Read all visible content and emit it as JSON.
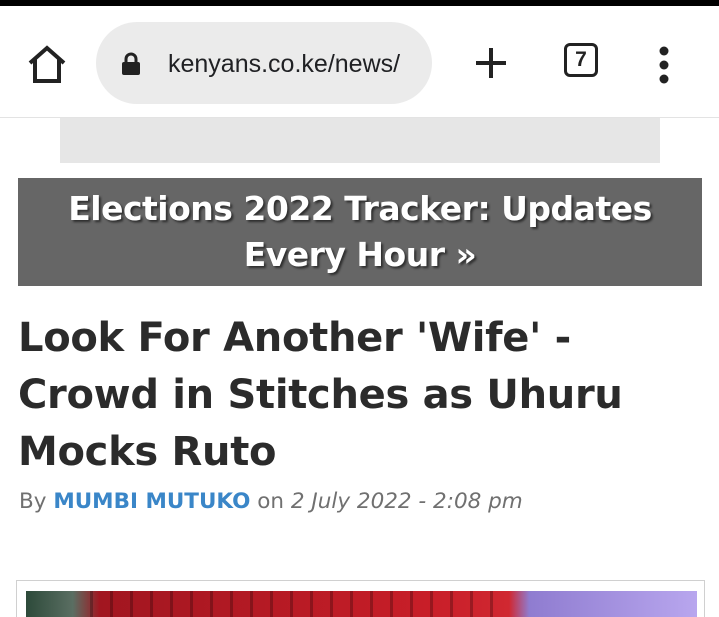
{
  "browser": {
    "url": "kenyans.co.ke/news/",
    "tab_count": "7",
    "icons": {
      "home": "home-icon",
      "lock": "lock-icon",
      "new_tab": "plus-icon",
      "menu": "more-vert-icon"
    }
  },
  "banner": {
    "tracker_text": "Elections 2022 Tracker: Updates Every Hour »"
  },
  "article": {
    "headline": "Look For Another 'Wife' - Crowd in Stitches as Uhuru Mocks Ruto",
    "byline_prefix": "By",
    "author": "MUMBI MUTUKO",
    "byline_on": "on",
    "date": "2 July 2022 - 2:08 pm"
  },
  "colors": {
    "banner_bg": "#666666",
    "author_link": "#3a86c8",
    "headline": "#2b2b2b",
    "omnibox_bg": "#ebebeb"
  }
}
